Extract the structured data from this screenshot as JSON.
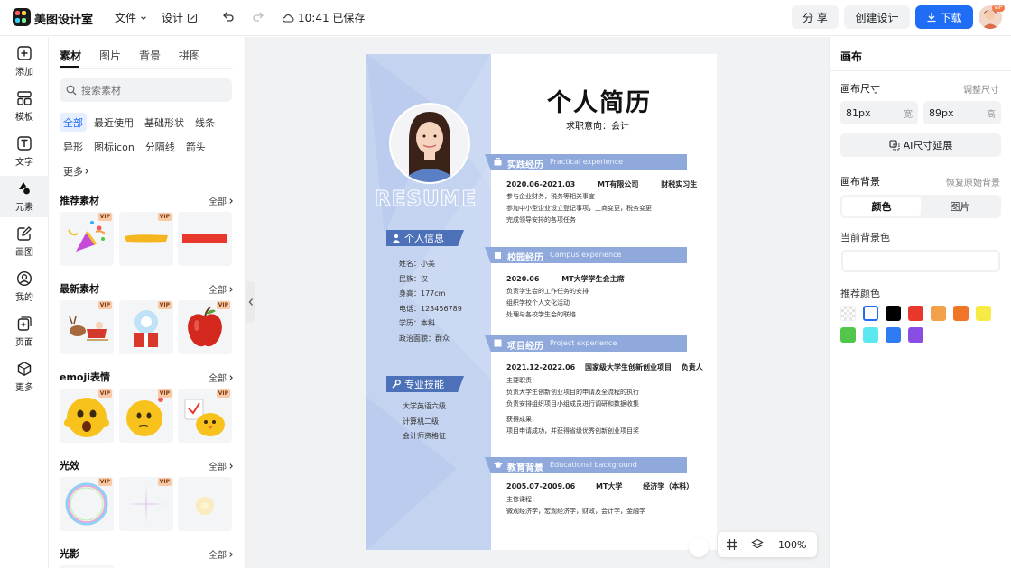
{
  "app": {
    "name": "美图设计室"
  },
  "topbar": {
    "file_menu": "文件",
    "design_menu": "设计",
    "saved_status": "10:41 已保存",
    "share_label": "分 享",
    "create_label": "创建设计",
    "download_label": "下载",
    "vip_badge": "VIP"
  },
  "left_nav": {
    "items": [
      {
        "label": "添加",
        "icon": "plus-square-icon"
      },
      {
        "label": "模板",
        "icon": "template-icon"
      },
      {
        "label": "文字",
        "icon": "text-icon"
      },
      {
        "label": "元素",
        "icon": "shapes-icon"
      },
      {
        "label": "画图",
        "icon": "pencil-icon"
      },
      {
        "label": "我的",
        "icon": "user-icon"
      },
      {
        "label": "页面",
        "icon": "add-page-icon"
      },
      {
        "label": "更多",
        "icon": "cube-icon"
      }
    ],
    "active": "元素"
  },
  "assets": {
    "tabs": [
      "素材",
      "图片",
      "背景",
      "拼图"
    ],
    "active_tab": "素材",
    "search_placeholder": "搜索素材",
    "chips": [
      "全部",
      "最近使用",
      "基础形状",
      "线条",
      "异形",
      "图标icon",
      "分隔线",
      "箭头",
      "更多"
    ],
    "active_chip": "全部",
    "all_label": "全部",
    "vip_label": "VIP",
    "sections": [
      {
        "title": "推荐素材",
        "items": [
          "party-popper",
          "yellow-brush-stroke",
          "red-bar"
        ]
      },
      {
        "title": "最新素材",
        "items": [
          "reindeer-sleigh",
          "snow-globe-gift",
          "red-apple"
        ]
      },
      {
        "title": "emoji表情",
        "items": [
          "scared-emoji",
          "thinking-emoji",
          "chick-emoji"
        ]
      },
      {
        "title": "光效",
        "items": [
          "bubble-ring",
          "sparkle-star",
          "soft-glow"
        ]
      },
      {
        "title": "光影",
        "items": []
      }
    ]
  },
  "resume": {
    "title": "个人简历",
    "subtitle": "求职意向：会计",
    "resume_word": "RESUME",
    "personal_info_title": "个人信息",
    "personal_info": [
      "姓名：小美",
      "民族：汉",
      "身高：177cm",
      "电话：123456789",
      "学历：本科",
      "政治面貌：群众"
    ],
    "skills_title": "专业技能",
    "skills": [
      "大学英语六级",
      "计算机二级",
      "会计师资格证"
    ],
    "sections": [
      {
        "title": "实践经历",
        "title_en": "Practical experience",
        "head": [
          "2020.06-2021.03",
          "MT有限公司",
          "财税实习生"
        ],
        "lines": [
          "参与企业财务，税务等相关事宜",
          "参加中小型企业设立登记事项，工商变更，税务变更",
          "完成领导安排的各项任务"
        ]
      },
      {
        "title": "校园经历",
        "title_en": "Campus experience",
        "head": [
          "2020.06",
          "MT大学学生会主席"
        ],
        "lines": [
          "负责学生会的工作任务的安排",
          "组织学校个人文化活动",
          "处理与各校学生会的联络"
        ]
      },
      {
        "title": "项目经历",
        "title_en": "Project experience",
        "head": [
          "2021.12-2022.06",
          "国家级大学生创新创业项目",
          "负责人"
        ],
        "lines": [
          "主要职责：",
          "负责大学生创新创业项目的申请及全流程的执行",
          "负责安排组织项目小组成员进行调研和数据收集",
          "获得成果：",
          "项目申请成功，并获得省级优秀创新创业项目奖"
        ]
      },
      {
        "title": "教育背景",
        "title_en": "Educational background",
        "head": [
          "2005.07-2009.06",
          "MT大学",
          "经济学（本科）"
        ],
        "lines": [
          "主修课程：",
          "微观经济学，宏观经济学，财政，会计学，金融学"
        ]
      }
    ]
  },
  "bottom_toolbar": {
    "zoom": "100%"
  },
  "right_panel": {
    "title": "画布",
    "size_label": "画布尺寸",
    "adjust_size": "调整尺寸",
    "width_value": "81px",
    "width_unit": "宽",
    "height_value": "89px",
    "height_unit": "高",
    "ai_extend": "AI尺寸延展",
    "bg_label": "画布背景",
    "restore_bg": "恢复原始背景",
    "seg": [
      "颜色",
      "图片"
    ],
    "active_seg": "颜色",
    "current_bg": "当前背景色",
    "recommend": "推荐颜色",
    "swatches": [
      "transparent",
      "#ffffff",
      "#000000",
      "#e8382b",
      "#f2a04a",
      "#f07527",
      "#f7ea45",
      "#52c64b",
      "#5ce8f0",
      "#2f7cf2",
      "#8a4de3"
    ],
    "selected_swatch": "#ffffff"
  },
  "colors": {
    "accent": "#1f6cf5",
    "resume_blue": "#4c71b8",
    "resume_light": "#c4d3ef",
    "resume_band": "#8fa9dd"
  }
}
